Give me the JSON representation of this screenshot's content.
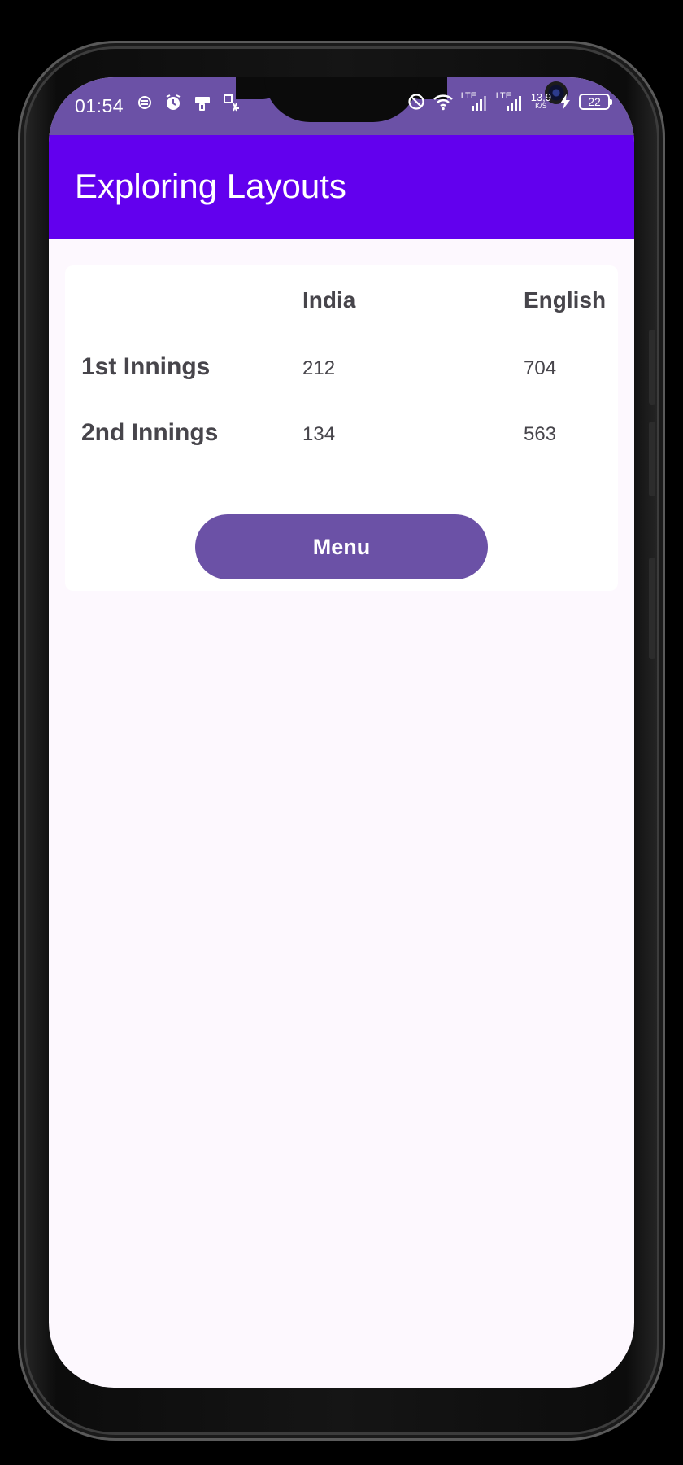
{
  "status_bar": {
    "time": "01:54",
    "left_icons": [
      "data-saver-icon",
      "alarm-icon",
      "phone-clean-icon",
      "translate-icon"
    ],
    "right_icons": [
      "dnd-icon",
      "wifi-icon",
      "signal-lte-1-icon",
      "signal-lte-2-icon",
      "speed-icon",
      "charging-icon",
      "battery-icon"
    ],
    "lte_label_1": "LTE",
    "lte_label_2": "LTE",
    "speed_value": "13,9",
    "speed_unit": "K/S",
    "battery_level": "22"
  },
  "app_bar": {
    "title": "Exploring Layouts",
    "color": "#6200ee"
  },
  "score_table": {
    "columns": [
      "",
      "India",
      "English"
    ],
    "rows": [
      {
        "label": "1st Innings",
        "india": "212",
        "english": "704"
      },
      {
        "label": "2nd Innings",
        "india": "134",
        "english": "563"
      }
    ]
  },
  "menu_button": {
    "label": "Menu",
    "color": "#6b51a6"
  },
  "colors": {
    "status_bar": "#6b51a6",
    "screen_background": "#fdf8fe",
    "text": "#47454b"
  }
}
